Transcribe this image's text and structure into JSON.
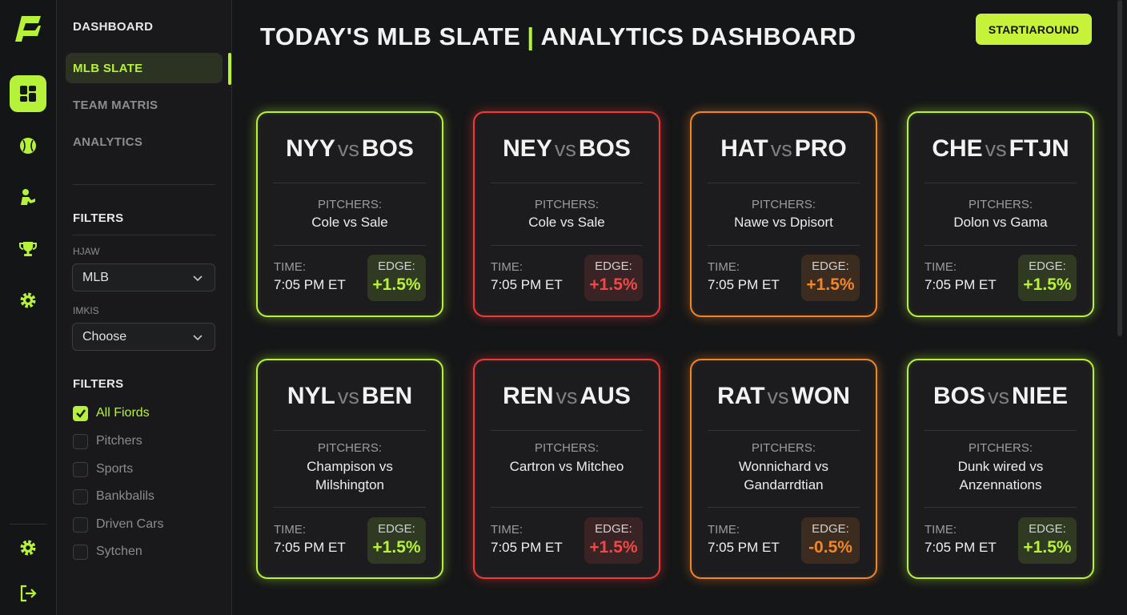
{
  "brand": {
    "accent": "#b6f23a",
    "red": "#f03a3a",
    "orange": "#f0852a"
  },
  "rail": {
    "icons": [
      "logo-icon",
      "dashboard-grid-icon",
      "baseball-icon",
      "player-icon",
      "trophy-icon",
      "settings-icon",
      "settings-icon",
      "logout-icon"
    ]
  },
  "nav": {
    "dashboard": "DASHBOARD",
    "mlb_slate": "MLB SLATE",
    "team_matris": "TEAM MATRIS",
    "analytics": "ANALYTICS"
  },
  "filters": {
    "heading": "FILTERS",
    "league_label": "HJAW",
    "league_value": "MLB",
    "inkis_label": "IMKIS",
    "inkis_value": "Choose",
    "heading2": "FILTERS",
    "checks": [
      {
        "label": "All Fiords",
        "checked": true
      },
      {
        "label": "Pitchers",
        "checked": false
      },
      {
        "label": "Sports",
        "checked": false
      },
      {
        "label": "Bankbalils",
        "checked": false
      },
      {
        "label": "Driven Cars",
        "checked": false
      },
      {
        "label": "Sytchen",
        "checked": false
      }
    ]
  },
  "header": {
    "title_left": "TODAY'S MLB SLATE",
    "title_sep": "|",
    "title_right": "ANALYTICS DASHBOARD",
    "cta": "STARTIAROUND"
  },
  "labels": {
    "vs": "vs",
    "pitchers": "PITCHERS:",
    "time": "TIME:",
    "edge": "EDGE:"
  },
  "games": [
    {
      "home": "NYY",
      "away": "BOS",
      "pitchers": "Cole vs Sale",
      "time": "7:05 PM ET",
      "edge": "+1.5%",
      "status": "green"
    },
    {
      "home": "NEY",
      "away": "BOS",
      "pitchers": "Cole vs Sale",
      "time": "7:05 PM ET",
      "edge": "+1.5%",
      "status": "red"
    },
    {
      "home": "HAT",
      "away": "PRO",
      "pitchers": "Nawe vs Dpisort",
      "time": "7:05 PM ET",
      "edge": "+1.5%",
      "status": "orange"
    },
    {
      "home": "CHE",
      "away": "FTJN",
      "pitchers": "Dolon vs Gama",
      "time": "7:05 PM ET",
      "edge": "+1.5%",
      "status": "green"
    },
    {
      "home": "NYL",
      "away": "BEN",
      "pitchers": "Champison vs Milshington",
      "time": "7:05 PM ET",
      "edge": "+1.5%",
      "status": "green"
    },
    {
      "home": "REN",
      "away": "AUS",
      "pitchers": "Cartron vs Mitcheo",
      "time": "7:05 PM ET",
      "edge": "+1.5%",
      "status": "red"
    },
    {
      "home": "RAT",
      "away": "WON",
      "pitchers": "Wonnichard vs Gandarrdtian",
      "time": "7:05 PM ET",
      "edge": "-0.5%",
      "status": "orange"
    },
    {
      "home": "BOS",
      "away": "NIEE",
      "pitchers": "Dunk wired vs Anzennations",
      "time": "7:05 PM ET",
      "edge": "+1.5%",
      "status": "green"
    }
  ]
}
